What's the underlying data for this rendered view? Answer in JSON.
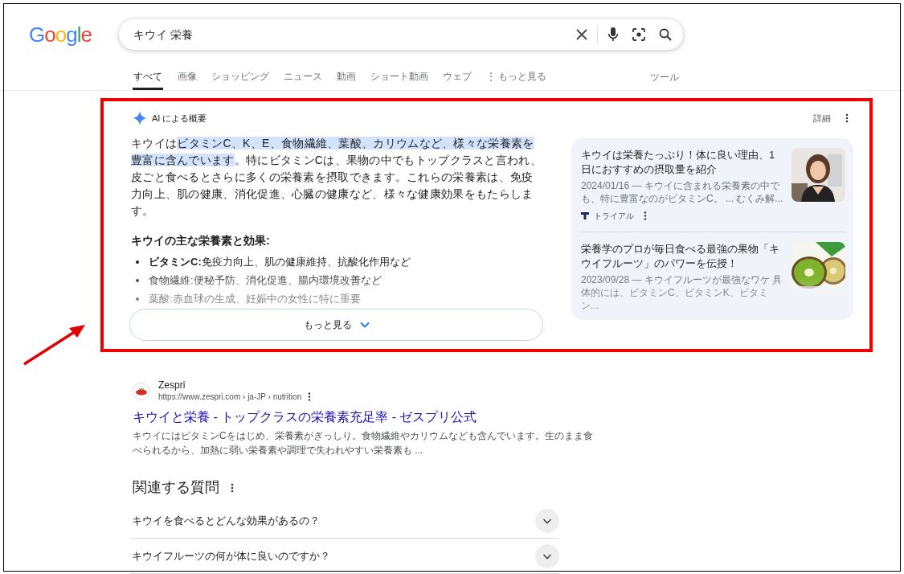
{
  "logo": "Google",
  "search": {
    "query": "キウイ 栄養"
  },
  "tabs": [
    {
      "label": "すべて",
      "selected": true
    },
    {
      "label": "画像",
      "selected": false
    },
    {
      "label": "ショッピング",
      "selected": false
    },
    {
      "label": "ニュース",
      "selected": false
    },
    {
      "label": "動画",
      "selected": false
    },
    {
      "label": "ショート動画",
      "selected": false
    },
    {
      "label": "ウェブ",
      "selected": false
    },
    {
      "label": "⋮ もっと見る",
      "selected": false
    }
  ],
  "tools_button": "ツール",
  "ai_overview": {
    "label": "AI による概要",
    "details_button": "詳細",
    "paragraph": [
      {
        "text": "キウイは",
        "highlighted": false
      },
      {
        "text": "ビタミンC、K、E、食物繊維、葉酸、カリウムなど、様々な栄養素を豊富に含んでいます",
        "highlighted": true
      },
      {
        "text": "。特にビタミンCは、果物の中でもトップクラスと言われ、皮ごと食べるとさらに多くの栄養素を摂取できます。これらの栄養素は、免疫力向上、肌の健康、消化促進、心臓の健康など、様々な健康効果をもたらします。",
        "highlighted": false
      }
    ],
    "heading": "キウイの主な栄養素と効果:",
    "bullets": [
      "**ビタミンC:**免疫力向上、肌の健康維持、抗酸化作用など",
      "食物繊維:便秘予防、消化促進、腸内環境改善など",
      "葉酸:赤血球の生成、妊娠中の女性に特に重要"
    ],
    "more_button": "もっと見る",
    "sources": [
      {
        "title": "キウイは栄養たっぷり！体に良い理由、1日におすすめの摂取量を紹介",
        "snippet": "2024/01/16 — キウイに含まれる栄養素の中でも、特に豊富なのがビタミンC。 ... むくみ解...",
        "source": "トライアル",
        "kind": "person"
      },
      {
        "title": "栄養学のプロが毎日食べる最強の果物「キウイフルーツ」のパワーを伝授！",
        "snippet": "2023/09/28 — キウイフルーツが最強なワケ 具体的には、ビタミンC、ビタミンK、ビタミン...",
        "kind": "kiwi"
      }
    ]
  },
  "result": {
    "site": "Zespri",
    "url": "https://www.zespri.com › ja-JP › nutrition",
    "title": "キウイと栄養 - トップクラスの栄養素充足率 - ゼスプリ公式",
    "snippet": "キウイにはビタミンCをはじめ、栄養素がぎっしり。食物繊維やカリウムなども含んでいます。生のまま食べられるから、加熱に弱い栄養素や調理で失われやすい栄養素も ..."
  },
  "related": {
    "heading": "関連する質問",
    "questions": [
      "キウイを食べるとどんな効果があるの？",
      "キウイフルーツの何が体に良いのですか？"
    ]
  }
}
